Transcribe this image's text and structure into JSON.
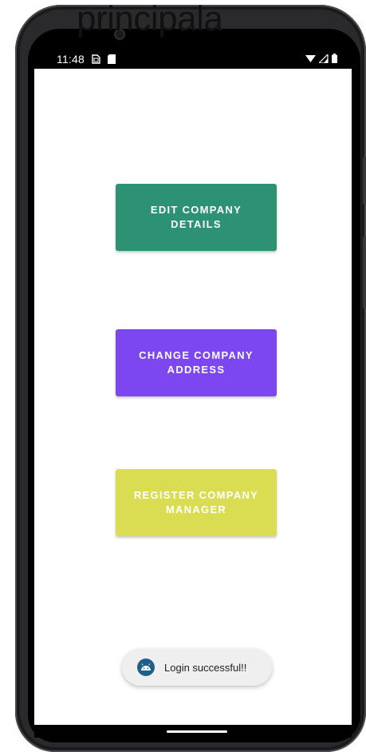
{
  "overlay": {
    "title": "principala"
  },
  "status_bar": {
    "time": "11:48",
    "icons_left": [
      "sim-icon",
      "sd-card-icon"
    ],
    "icons_right": [
      "wifi-icon",
      "signal-icon",
      "battery-icon"
    ]
  },
  "buttons": [
    {
      "label": "EDIT COMPANY DETAILS",
      "color": "#2C9273"
    },
    {
      "label": "CHANGE COMPANY ADDRESS",
      "color": "#7C46F1"
    },
    {
      "label": "REGISTER COMPANY MANAGER",
      "color": "#DADD52"
    }
  ],
  "toast": {
    "message": "Login successful!!",
    "icon": "android-icon"
  },
  "colors": {
    "status_bar_bg": "#000000",
    "screen_bg": "#FFFFFF",
    "toast_bg": "#EFEFEF",
    "toast_icon": "#1E5F8A"
  }
}
